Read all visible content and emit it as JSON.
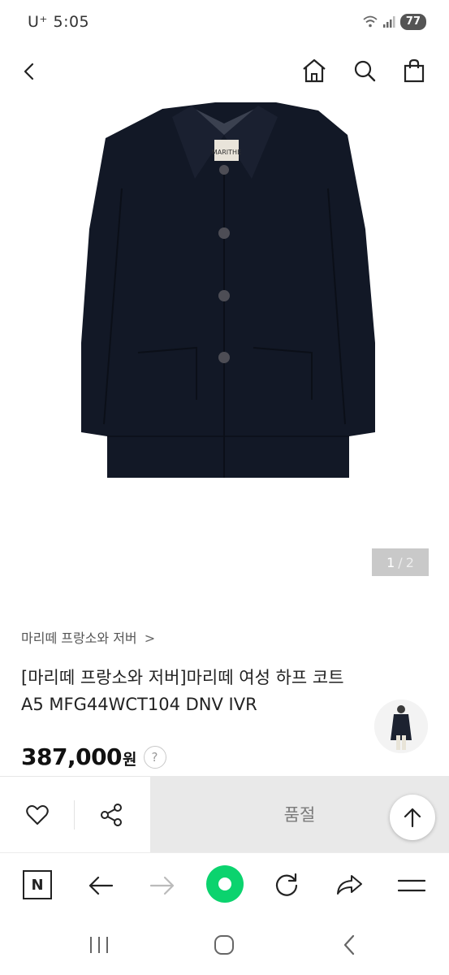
{
  "status": {
    "carrier_time": "U⁺ 5:05",
    "battery": "77"
  },
  "header": {
    "back_icon": "chevron-left-icon",
    "home_icon": "house-icon",
    "search_icon": "search-icon",
    "cart_icon": "shopping-bag-icon"
  },
  "gallery": {
    "current": "1",
    "separator": "/",
    "total": "2"
  },
  "product": {
    "brand": "마리떼 프랑소와 저버",
    "brand_chevron": ">",
    "title": "[마리떼 프랑소와 저버]마리떼 여성 하프 코트 A5 MFG44WCT104 DNV IVR",
    "price": "387,000",
    "currency": "원",
    "help": "?",
    "garment_label": "MARITHE"
  },
  "actions": {
    "like_icon": "heart-icon",
    "share_icon": "share-icon",
    "soldout_label": "품절",
    "top_icon": "arrow-up-icon"
  },
  "browser": {
    "naver_label": "N",
    "icons": [
      "naver-icon",
      "back-arrow-icon",
      "forward-arrow-icon",
      "home-dot-icon",
      "refresh-icon",
      "share-arrow-icon",
      "menu-icon"
    ]
  },
  "colors": {
    "accent_green": "#0bd36e",
    "coat_navy": "#121826",
    "soldout_bg": "#e9e9e9"
  }
}
